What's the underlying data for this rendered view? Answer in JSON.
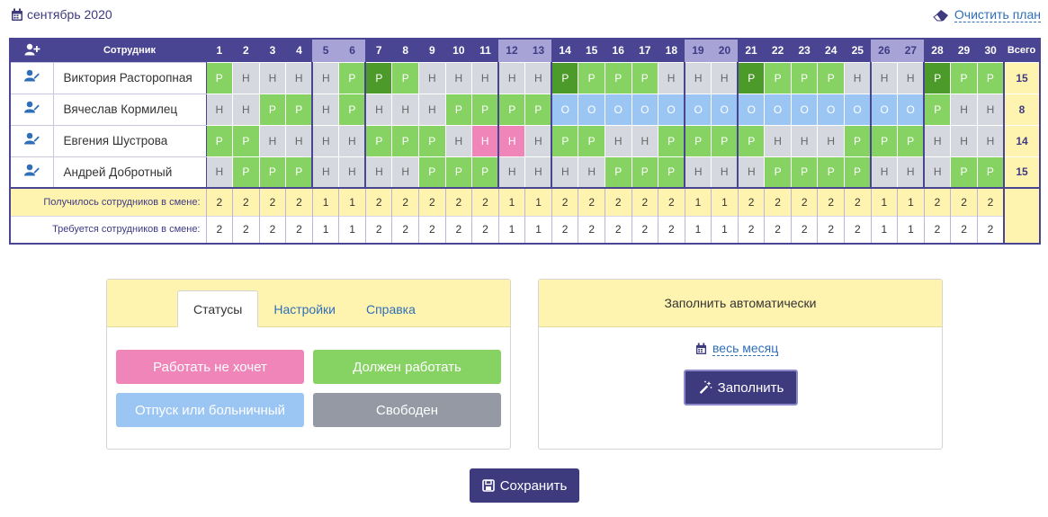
{
  "header": {
    "month_label": "сентябрь 2020",
    "clear_plan_label": "Очистить план"
  },
  "table": {
    "employee_col_label": "Сотрудник",
    "total_col_label": "Всего",
    "days": [
      "1",
      "2",
      "3",
      "4",
      "5",
      "6",
      "7",
      "8",
      "9",
      "10",
      "11",
      "12",
      "13",
      "14",
      "15",
      "16",
      "17",
      "18",
      "19",
      "20",
      "21",
      "22",
      "23",
      "24",
      "25",
      "26",
      "27",
      "28",
      "29",
      "30"
    ],
    "weekend_days": [
      5,
      6,
      12,
      13,
      19,
      20,
      26,
      27
    ],
    "employees": [
      {
        "name": "Виктория Расторопная",
        "total": "15",
        "cells": [
          "P",
          "Н",
          "Н",
          "Н",
          "Н",
          "P",
          "P*",
          "P",
          "Н",
          "Н",
          "Н",
          "Н",
          "Н",
          "P*",
          "P",
          "P",
          "P",
          "Н",
          "Н",
          "Н",
          "P*",
          "P",
          "P",
          "P",
          "Н",
          "Н",
          "Н",
          "P*",
          "P",
          "P"
        ]
      },
      {
        "name": "Вячеслав Кормилец",
        "total": "8",
        "cells": [
          "Н",
          "Н",
          "P",
          "P",
          "Н",
          "P",
          "Н",
          "Н",
          "Н",
          "P",
          "P",
          "P",
          "P",
          "О",
          "О",
          "О",
          "О",
          "О",
          "О",
          "О",
          "О",
          "О",
          "О",
          "О",
          "О",
          "О",
          "О",
          "P",
          "Н",
          "Н"
        ]
      },
      {
        "name": "Евгения Шустрова",
        "total": "14",
        "cells": [
          "P",
          "P",
          "Н",
          "Н",
          "Н",
          "Н",
          "P",
          "P",
          "P",
          "Н",
          "Н!",
          "Н!",
          "Н",
          "P",
          "P",
          "Н",
          "Н",
          "P",
          "P",
          "P",
          "P",
          "Н",
          "Н",
          "Н",
          "P",
          "P",
          "P",
          "Н",
          "Н",
          "Н"
        ]
      },
      {
        "name": "Андрей Добротный",
        "total": "15",
        "cells": [
          "Н",
          "P",
          "P",
          "P",
          "Н",
          "Н",
          "Н",
          "Н",
          "P",
          "P",
          "P",
          "Н",
          "Н",
          "Н",
          "Н",
          "P",
          "P",
          "P",
          "Н",
          "Н",
          "Н",
          "P",
          "P",
          "P",
          "P",
          "Н",
          "Н",
          "Н",
          "P",
          "P"
        ]
      }
    ],
    "got_label": "Получилось сотрудников в смене:",
    "got_values": [
      "2",
      "2",
      "2",
      "2",
      "1",
      "1",
      "2",
      "2",
      "2",
      "2",
      "2",
      "1",
      "1",
      "2",
      "2",
      "2",
      "2",
      "2",
      "1",
      "1",
      "2",
      "2",
      "2",
      "2",
      "2",
      "1",
      "1",
      "2",
      "2",
      "2"
    ],
    "need_label": "Требуется сотрудников в смене:",
    "need_values": [
      "2",
      "2",
      "2",
      "2",
      "1",
      "1",
      "2",
      "2",
      "2",
      "2",
      "2",
      "1",
      "1",
      "2",
      "2",
      "2",
      "2",
      "2",
      "1",
      "1",
      "2",
      "2",
      "2",
      "2",
      "2",
      "1",
      "1",
      "2",
      "2",
      "2"
    ]
  },
  "left_panel": {
    "tabs": [
      "Статусы",
      "Настройки",
      "Справка"
    ],
    "active_tab": "Статусы",
    "status_buttons": [
      {
        "label": "Работать не хочет",
        "color": "#ef85b8"
      },
      {
        "label": "Должен работать",
        "color": "#86d363"
      },
      {
        "label": "Отпуск или больничный",
        "color": "#9bc6f3"
      },
      {
        "label": "Свободен",
        "color": "#9499a3"
      }
    ]
  },
  "right_panel": {
    "title": "Заполнить автоматически",
    "period_label": "весь месяц",
    "fill_label": "Заполнить"
  },
  "save_label": "Сохранить",
  "colors": {
    "accent": "#4a4592",
    "work": "#86d363",
    "work_dark": "#4c9a2a",
    "off": "#d5d8de",
    "vacation": "#9bc6f3",
    "not_want": "#ef85b8",
    "highlight": "#fff3b0"
  },
  "cell_legend": {
    "P": "Р",
    "P*": "Р",
    "Н": "Н",
    "Н!": "Н",
    "О": "О"
  }
}
